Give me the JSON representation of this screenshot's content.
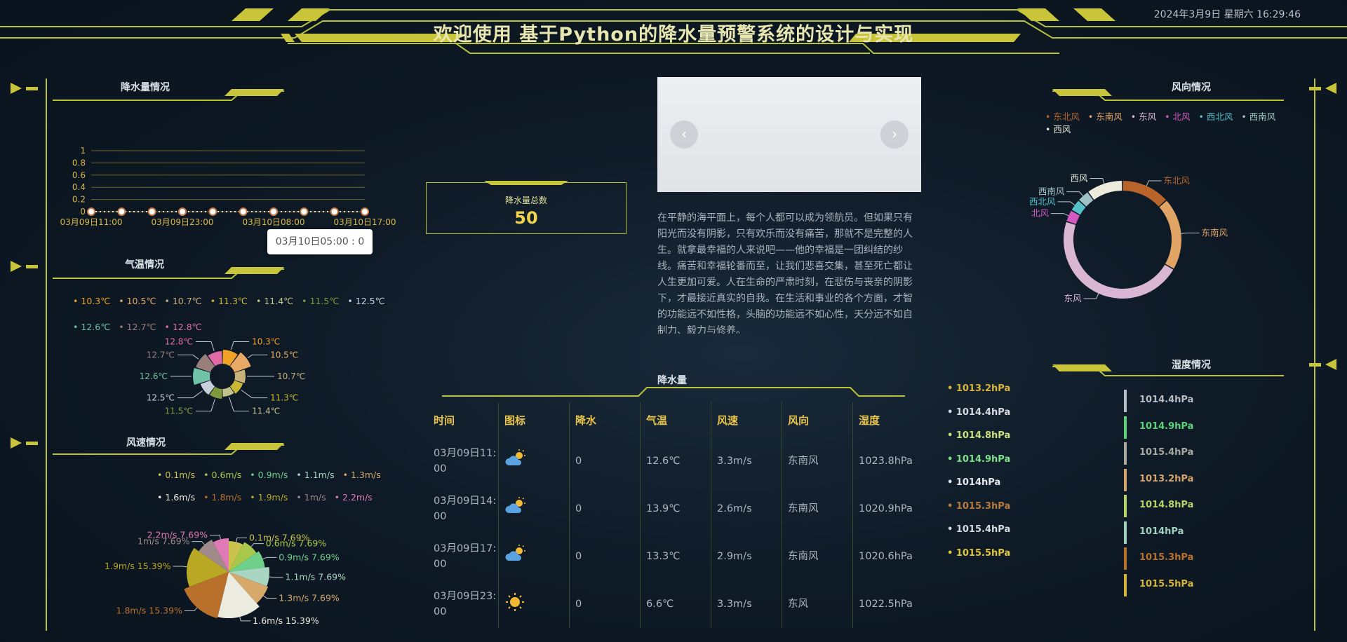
{
  "header": {
    "title": "欢迎使用 基于Python的降水量预警系统的设计与实现",
    "datetime": "2024年3月9日 星期六 16:29:46"
  },
  "rainfall_panel": {
    "title": "降水量情况",
    "tooltip": "03月10日05:00 : 0",
    "chart_data": {
      "type": "line",
      "y_ticks": [
        "1",
        "0.8",
        "0.6",
        "0.4",
        "0.2",
        "0"
      ],
      "x_labels": [
        "03月09日11:00",
        "03月09日23:00",
        "03月10日08:00",
        "03月10日17:00"
      ],
      "values": [
        0,
        0,
        0,
        0,
        0,
        0,
        0,
        0,
        0,
        0
      ],
      "ylim": [
        0,
        1
      ]
    }
  },
  "temperature_panel": {
    "title": "气温情况",
    "chart_data": {
      "type": "pie",
      "legend": [
        {
          "label": "10.3℃",
          "color": "#f0a224"
        },
        {
          "label": "10.5℃",
          "color": "#e8a964"
        },
        {
          "label": "10.7℃",
          "color": "#c8b07a"
        },
        {
          "label": "11.3℃",
          "color": "#c9b833"
        },
        {
          "label": "11.4℃",
          "color": "#c2c28a"
        },
        {
          "label": "11.5℃",
          "color": "#7e9a3c"
        },
        {
          "label": "12.5℃",
          "color": "#c8d0dc"
        },
        {
          "label": "12.6℃",
          "color": "#6fc2a6"
        },
        {
          "label": "12.7℃",
          "color": "#9a7e7a"
        },
        {
          "label": "12.8℃",
          "color": "#e06aa6"
        }
      ],
      "values": [
        1,
        1,
        1,
        1,
        1,
        1,
        1,
        1,
        1,
        1
      ]
    }
  },
  "windspeed_panel": {
    "title": "风速情况",
    "chart_data": {
      "type": "pie",
      "legend": [
        {
          "label": "0.1m/s",
          "color": "#c9c24c"
        },
        {
          "label": "0.6m/s",
          "color": "#a8c84c"
        },
        {
          "label": "0.9m/s",
          "color": "#6fd08c"
        },
        {
          "label": "1.1m/s",
          "color": "#a9d6c2"
        },
        {
          "label": "1.3m/s",
          "color": "#d6a86a"
        },
        {
          "label": "1.6m/s",
          "color": "#ecebe0"
        },
        {
          "label": "1.8m/s",
          "color": "#b8702a"
        },
        {
          "label": "1.9m/s",
          "color": "#b8a824"
        },
        {
          "label": "1m/s",
          "color": "#a08a8a"
        },
        {
          "label": "2.2m/s",
          "color": "#e07ab4"
        }
      ],
      "slices": [
        {
          "label": "0.1m/s 7.69%",
          "value": 7.69
        },
        {
          "label": "0.6m/s 7.69%",
          "value": 7.69
        },
        {
          "label": "0.9m/s 7.69%",
          "value": 7.69
        },
        {
          "label": "1.1m/s 7.69%",
          "value": 7.69
        },
        {
          "label": "1.3m/s 7.69%",
          "value": 7.69
        },
        {
          "label": "1.6m/s 15.39%",
          "value": 15.39
        },
        {
          "label": "1.8m/s 15.39%",
          "value": 15.39
        },
        {
          "label": "1.9m/s 15.39%",
          "value": 15.39
        },
        {
          "label": "1m/s 7.69%",
          "value": 7.69
        },
        {
          "label": "2.2m/s 7.69%",
          "value": 7.69
        }
      ]
    }
  },
  "slider": {
    "prev": "‹",
    "next": "›"
  },
  "total": {
    "label": "降水量总数",
    "value": "50"
  },
  "article": "在平静的海平面上，每个人都可以成为领航员。但如果只有阳光而没有阴影，只有欢乐而没有痛苦，那就不是完整的人生。就拿最幸福的人来说吧——他的幸福是一团纠结的纱线。痛苦和幸福轮番而至，让我们悲喜交集，甚至死亡都让人生更加可爱。人在生命的严肃时刻，在悲伤与丧亲的阴影下，才最接近真实的自我。在生活和事业的各个方面，才智的功能远不如性格，头脑的功能远不如心性，天分远不如自制力、毅力与修养。",
  "table": {
    "title": "降水量",
    "headers": [
      "时间",
      "图标",
      "降水",
      "气温",
      "风速",
      "风向",
      "湿度"
    ],
    "rows": [
      {
        "time": "03月09日11:00",
        "icon": "cloudy-sun",
        "rain": "0",
        "temp": "12.6℃",
        "wind": "3.3m/s",
        "dir": "东南风",
        "hum": "1023.8hPa"
      },
      {
        "time": "03月09日14:00",
        "icon": "cloudy-sun",
        "rain": "0",
        "temp": "13.9℃",
        "wind": "2.6m/s",
        "dir": "东南风",
        "hum": "1020.9hPa"
      },
      {
        "time": "03月09日17:00",
        "icon": "cloudy-sun",
        "rain": "0",
        "temp": "13.3℃",
        "wind": "2.9m/s",
        "dir": "东南风",
        "hum": "1020.6hPa"
      },
      {
        "time": "03月09日23:00",
        "icon": "sun",
        "rain": "0",
        "temp": "6.6℃",
        "wind": "3.3m/s",
        "dir": "东风",
        "hum": "1022.5hPa"
      }
    ]
  },
  "pressure_list": [
    {
      "label": "1013.2hPa",
      "color": "#d8b43a"
    },
    {
      "label": "1014.4hPa",
      "color": "#d6dadf"
    },
    {
      "label": "1014.8hPa",
      "color": "#cbe07a"
    },
    {
      "label": "1014.9hPa",
      "color": "#7fe08a"
    },
    {
      "label": "1014hPa",
      "color": "#e4e8ec"
    },
    {
      "label": "1015.3hPa",
      "color": "#b87a3a"
    },
    {
      "label": "1015.4hPa",
      "color": "#d6dadf"
    },
    {
      "label": "1015.5hPa",
      "color": "#e0c43a"
    }
  ],
  "wind_direction_panel": {
    "title": "风向情况",
    "chart_data": {
      "type": "pie",
      "legend": [
        {
          "label": "东北风",
          "color": "#b8642a"
        },
        {
          "label": "东南风",
          "color": "#e0a464"
        },
        {
          "label": "东风",
          "color": "#d9b6d2"
        },
        {
          "label": "北风",
          "color": "#d35ac0"
        },
        {
          "label": "西北风",
          "color": "#54c0c8"
        },
        {
          "label": "西南风",
          "color": "#9fc2c6"
        },
        {
          "label": "西风",
          "color": "#ecebdc"
        }
      ],
      "values": [
        2,
        3,
        7,
        0.5,
        0.5,
        0.5,
        1.5
      ]
    }
  },
  "humidity_panel": {
    "title": "湿度情况",
    "items": [
      {
        "label": "1014.4hPa",
        "color": "#b9bcc2"
      },
      {
        "label": "1014.9hPa",
        "color": "#5ed27a"
      },
      {
        "label": "1015.4hPa",
        "color": "#a9a9a0"
      },
      {
        "label": "1013.2hPa",
        "color": "#d6a46a"
      },
      {
        "label": "1014.8hPa",
        "color": "#b6d46a"
      },
      {
        "label": "1014hPa",
        "color": "#9fd0c0"
      },
      {
        "label": "1015.3hPa",
        "color": "#b8702a"
      },
      {
        "label": "1015.5hPa",
        "color": "#d4b43a"
      }
    ]
  }
}
